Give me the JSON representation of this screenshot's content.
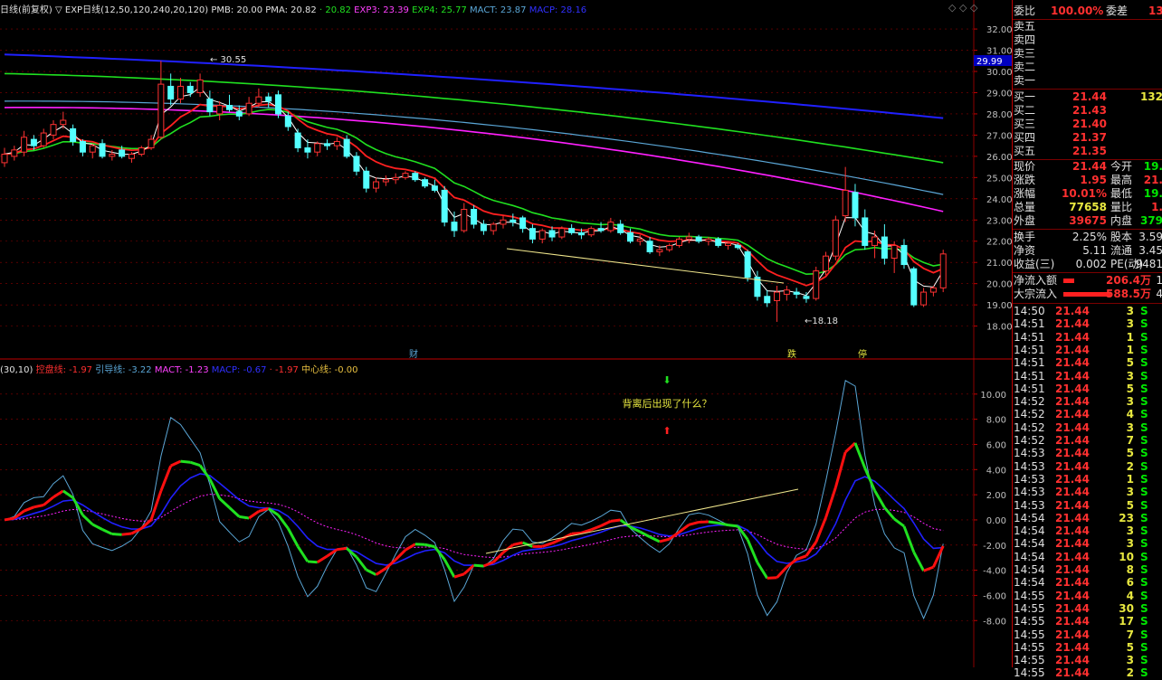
{
  "colors": {
    "up": "#ff3232",
    "down": "#54ffff",
    "ma_white": "#ffffff",
    "ma_red": "#ff2020",
    "ma_green": "#20e020",
    "ma_blue": "#2020ff",
    "ma_magenta": "#ff20ff",
    "ma_skyblue": "#5aa6d6",
    "grid": "#8b0000"
  },
  "main_header": {
    "period": "日线(前复权)",
    "indicator": "▽ EXP日线(12,50,120,240,20,120)",
    "pmb": "PMB: 20.00",
    "pma": "PMA: 20.82",
    "exp2": "· 20.82",
    "exp3": "EXP3: 23.39",
    "exp4": "EXP4: 25.77",
    "mact": "MACT: 23.87",
    "macp": "MACP: 28.16"
  },
  "main_annotations": {
    "high": "30.55",
    "low": "18.18",
    "tag_cai": "财",
    "tag_die": "跌",
    "tag_ting": "停",
    "price_box": "29.99"
  },
  "sub_header": {
    "params": "(30,10)",
    "kongpan": "控盘线: -1.97",
    "yindao": "引导线: -3.22",
    "mact": "MACT: -1.23",
    "macp": "MACP: -0.67",
    "extra": "· -1.97",
    "zhongxin": "中心线: -0.00"
  },
  "sub_annotations": {
    "question": "背离后出现了什么？"
  },
  "window_icons": [
    "◇",
    "◇",
    "◇"
  ],
  "chart_data": [
    {
      "type": "candlestick",
      "ylim": [
        17.6,
        32.6
      ],
      "ticks": [
        "32.00",
        "31.00",
        "30.00",
        "29.00",
        "28.00",
        "27.00",
        "26.00",
        "25.00",
        "24.00",
        "23.00",
        "22.00",
        "21.00",
        "20.00",
        "19.00",
        "18.00"
      ],
      "ohlc": [
        [
          25.7,
          26.4,
          25.5,
          26.1
        ],
        [
          26.0,
          26.5,
          25.8,
          26.3
        ],
        [
          26.2,
          27.2,
          26.0,
          26.9
        ],
        [
          26.8,
          27.0,
          26.3,
          26.5
        ],
        [
          26.5,
          27.3,
          26.4,
          27.1
        ],
        [
          27.0,
          27.7,
          26.8,
          27.5
        ],
        [
          27.5,
          28.1,
          27.3,
          27.7
        ],
        [
          27.3,
          27.5,
          26.5,
          26.7
        ],
        [
          26.7,
          26.8,
          26.0,
          26.2
        ],
        [
          26.2,
          26.6,
          25.9,
          26.5
        ],
        [
          26.6,
          26.8,
          25.9,
          26.0
        ],
        [
          26.0,
          26.3,
          25.8,
          26.1
        ],
        [
          26.3,
          26.5,
          25.9,
          26.0
        ],
        [
          25.9,
          26.2,
          25.7,
          26.1
        ],
        [
          26.1,
          26.5,
          26.0,
          26.4
        ],
        [
          26.4,
          27.0,
          26.3,
          26.8
        ],
        [
          26.9,
          30.5,
          26.8,
          29.4
        ],
        [
          29.3,
          29.9,
          28.4,
          28.7
        ],
        [
          28.7,
          29.7,
          28.5,
          29.3
        ],
        [
          29.3,
          29.5,
          28.8,
          29.0
        ],
        [
          29.0,
          29.9,
          28.8,
          29.6
        ],
        [
          28.7,
          29.1,
          27.9,
          28.1
        ],
        [
          28.0,
          28.6,
          27.7,
          28.4
        ],
        [
          28.4,
          28.9,
          28.1,
          28.2
        ],
        [
          28.1,
          28.4,
          27.7,
          27.9
        ],
        [
          28.0,
          28.8,
          27.9,
          28.5
        ],
        [
          28.5,
          29.2,
          28.3,
          28.8
        ],
        [
          28.8,
          29.0,
          28.3,
          28.6
        ],
        [
          28.9,
          29.1,
          27.8,
          28.0
        ],
        [
          27.9,
          28.1,
          27.2,
          27.4
        ],
        [
          27.1,
          27.3,
          26.2,
          26.4
        ],
        [
          26.4,
          26.8,
          25.9,
          26.2
        ],
        [
          26.2,
          26.7,
          26.0,
          26.6
        ],
        [
          26.6,
          26.8,
          26.3,
          26.5
        ],
        [
          26.5,
          26.9,
          26.3,
          26.7
        ],
        [
          26.8,
          27.0,
          25.9,
          26.0
        ],
        [
          26.0,
          26.2,
          25.1,
          25.3
        ],
        [
          25.3,
          25.5,
          24.3,
          24.5
        ],
        [
          24.5,
          25.0,
          24.3,
          24.8
        ],
        [
          24.8,
          25.1,
          24.6,
          24.9
        ],
        [
          24.9,
          25.2,
          24.7,
          25.0
        ],
        [
          25.0,
          25.3,
          24.9,
          25.2
        ],
        [
          25.2,
          25.3,
          24.8,
          24.9
        ],
        [
          24.9,
          25.0,
          24.5,
          24.6
        ],
        [
          24.6,
          24.9,
          24.3,
          24.4
        ],
        [
          24.4,
          24.6,
          22.7,
          22.9
        ],
        [
          22.9,
          23.4,
          22.2,
          22.5
        ],
        [
          22.5,
          23.8,
          22.4,
          23.5
        ],
        [
          23.5,
          23.7,
          22.6,
          22.8
        ],
        [
          22.8,
          23.0,
          22.3,
          22.5
        ],
        [
          22.5,
          22.9,
          22.3,
          22.8
        ],
        [
          22.8,
          23.2,
          22.6,
          23.0
        ],
        [
          23.0,
          23.3,
          22.7,
          22.9
        ],
        [
          23.1,
          23.2,
          22.4,
          22.6
        ],
        [
          22.6,
          22.8,
          21.9,
          22.1
        ],
        [
          22.1,
          22.6,
          21.9,
          22.5
        ],
        [
          22.5,
          22.7,
          22.0,
          22.2
        ],
        [
          22.2,
          22.7,
          22.1,
          22.6
        ],
        [
          22.6,
          22.8,
          22.3,
          22.4
        ],
        [
          22.4,
          22.6,
          22.1,
          22.3
        ],
        [
          22.3,
          22.7,
          22.2,
          22.6
        ],
        [
          22.6,
          22.9,
          22.4,
          22.5
        ],
        [
          22.5,
          23.1,
          22.4,
          22.9
        ],
        [
          22.8,
          23.0,
          22.3,
          22.4
        ],
        [
          22.4,
          22.6,
          21.9,
          22.0
        ],
        [
          22.0,
          22.3,
          21.8,
          22.1
        ],
        [
          22.0,
          22.2,
          21.4,
          21.5
        ],
        [
          21.5,
          21.8,
          21.3,
          21.6
        ],
        [
          21.6,
          21.9,
          21.5,
          21.8
        ],
        [
          21.8,
          22.2,
          21.7,
          22.1
        ],
        [
          22.1,
          22.4,
          21.9,
          22.2
        ],
        [
          22.2,
          22.3,
          21.9,
          22.0
        ],
        [
          22.0,
          22.2,
          21.8,
          22.1
        ],
        [
          22.1,
          22.2,
          21.7,
          21.8
        ],
        [
          21.8,
          22.0,
          21.6,
          21.9
        ],
        [
          21.8,
          21.9,
          21.6,
          21.7
        ],
        [
          21.5,
          21.6,
          20.1,
          20.3
        ],
        [
          20.3,
          20.6,
          19.2,
          19.4
        ],
        [
          19.4,
          19.7,
          18.9,
          19.1
        ],
        [
          19.2,
          19.9,
          18.2,
          19.6
        ],
        [
          19.5,
          19.9,
          19.2,
          19.7
        ],
        [
          19.6,
          19.8,
          19.3,
          19.5
        ],
        [
          19.4,
          19.6,
          19.1,
          19.3
        ],
        [
          19.3,
          20.8,
          19.2,
          20.6
        ],
        [
          20.6,
          21.5,
          20.4,
          21.3
        ],
        [
          21.3,
          23.2,
          21.1,
          23.0
        ],
        [
          23.2,
          25.5,
          22.9,
          24.4
        ],
        [
          24.3,
          24.7,
          22.7,
          23.1
        ],
        [
          23.1,
          23.5,
          21.6,
          21.8
        ],
        [
          21.8,
          22.5,
          21.2,
          22.2
        ],
        [
          22.2,
          22.8,
          20.9,
          21.2
        ],
        [
          21.2,
          22.0,
          20.5,
          21.8
        ],
        [
          21.8,
          22.1,
          20.7,
          20.9
        ],
        [
          20.7,
          20.8,
          18.9,
          19.0
        ],
        [
          19.0,
          19.8,
          18.9,
          19.6
        ],
        [
          19.6,
          19.9,
          19.4,
          19.8
        ],
        [
          19.8,
          21.6,
          19.6,
          21.4
        ]
      ]
    },
    {
      "type": "line",
      "ylim": [
        -11.0,
        12.0
      ],
      "ticks": [
        "10.00",
        "8.00",
        "6.00",
        "4.00",
        "2.00",
        "0.00",
        "-2.00",
        "-4.00",
        "-6.00",
        "-8.00"
      ]
    }
  ],
  "sidebar": {
    "weibi": {
      "label": "委比",
      "value": "100.00%",
      "label2": "委差",
      "value2": "13"
    },
    "sells": [
      {
        "label": "卖五"
      },
      {
        "label": "卖四"
      },
      {
        "label": "卖三"
      },
      {
        "label": "卖二"
      },
      {
        "label": "卖一"
      }
    ],
    "buys": [
      {
        "label": "买一",
        "price": "21.44",
        "vol": "132"
      },
      {
        "label": "买二",
        "price": "21.43",
        "vol": ""
      },
      {
        "label": "买三",
        "price": "21.40",
        "vol": ""
      },
      {
        "label": "买四",
        "price": "21.37",
        "vol": ""
      },
      {
        "label": "买五",
        "price": "21.35",
        "vol": ""
      }
    ],
    "quote": [
      {
        "l1": "现价",
        "v1": "21.44",
        "l2": "今开",
        "v2": "19.",
        "c1": "red",
        "c2": "green"
      },
      {
        "l1": "涨跌",
        "v1": "1.95",
        "l2": "最高",
        "v2": "21.",
        "c1": "red",
        "c2": "red"
      },
      {
        "l1": "涨幅",
        "v1": "10.01%",
        "l2": "最低",
        "v2": "19.",
        "c1": "red",
        "c2": "green"
      },
      {
        "l1": "总量",
        "v1": "77658",
        "l2": "量比",
        "v2": "1.",
        "c1": "yellow",
        "c2": "red"
      },
      {
        "l1": "外盘",
        "v1": "39675",
        "l2": "内盘",
        "v2": "379",
        "c1": "red",
        "c2": "green"
      }
    ],
    "stats": [
      {
        "l1": "换手",
        "v1": "2.25%",
        "l2": "股本",
        "v2": "3.59"
      },
      {
        "l1": "净资",
        "v1": "5.11",
        "l2": "流通",
        "v2": "3.45"
      },
      {
        "l1": "收益(三)",
        "v1": "0.002",
        "l2": "PE(动)",
        "v2": "9481"
      }
    ],
    "flow": [
      {
        "label": "净流入额",
        "value": "206.4万",
        "tail": "1"
      },
      {
        "label": "大宗流入",
        "value": "588.5万",
        "tail": "4"
      }
    ],
    "ticks": [
      {
        "t": "14:50",
        "p": "21.44",
        "v": "3",
        "s": "S"
      },
      {
        "t": "14:51",
        "p": "21.44",
        "v": "3",
        "s": "S"
      },
      {
        "t": "14:51",
        "p": "21.44",
        "v": "1",
        "s": "S"
      },
      {
        "t": "14:51",
        "p": "21.44",
        "v": "1",
        "s": "S"
      },
      {
        "t": "14:51",
        "p": "21.44",
        "v": "5",
        "s": "S"
      },
      {
        "t": "14:51",
        "p": "21.44",
        "v": "3",
        "s": "S"
      },
      {
        "t": "14:51",
        "p": "21.44",
        "v": "5",
        "s": "S"
      },
      {
        "t": "14:52",
        "p": "21.44",
        "v": "3",
        "s": "S"
      },
      {
        "t": "14:52",
        "p": "21.44",
        "v": "4",
        "s": "S"
      },
      {
        "t": "14:52",
        "p": "21.44",
        "v": "3",
        "s": "S"
      },
      {
        "t": "14:52",
        "p": "21.44",
        "v": "7",
        "s": "S"
      },
      {
        "t": "14:53",
        "p": "21.44",
        "v": "5",
        "s": "S"
      },
      {
        "t": "14:53",
        "p": "21.44",
        "v": "2",
        "s": "S"
      },
      {
        "t": "14:53",
        "p": "21.44",
        "v": "1",
        "s": "S"
      },
      {
        "t": "14:53",
        "p": "21.44",
        "v": "3",
        "s": "S"
      },
      {
        "t": "14:53",
        "p": "21.44",
        "v": "5",
        "s": "S"
      },
      {
        "t": "14:54",
        "p": "21.44",
        "v": "23",
        "s": "S"
      },
      {
        "t": "14:54",
        "p": "21.44",
        "v": "3",
        "s": "S"
      },
      {
        "t": "14:54",
        "p": "21.44",
        "v": "3",
        "s": "S"
      },
      {
        "t": "14:54",
        "p": "21.44",
        "v": "10",
        "s": "S"
      },
      {
        "t": "14:54",
        "p": "21.44",
        "v": "8",
        "s": "S"
      },
      {
        "t": "14:54",
        "p": "21.44",
        "v": "6",
        "s": "S"
      },
      {
        "t": "14:55",
        "p": "21.44",
        "v": "4",
        "s": "S"
      },
      {
        "t": "14:55",
        "p": "21.44",
        "v": "30",
        "s": "S"
      },
      {
        "t": "14:55",
        "p": "21.44",
        "v": "17",
        "s": "S"
      },
      {
        "t": "14:55",
        "p": "21.44",
        "v": "7",
        "s": "S"
      },
      {
        "t": "14:55",
        "p": "21.44",
        "v": "5",
        "s": "S"
      },
      {
        "t": "14:55",
        "p": "21.44",
        "v": "3",
        "s": "S"
      },
      {
        "t": "14:55",
        "p": "21.44",
        "v": "2",
        "s": "S"
      }
    ]
  }
}
